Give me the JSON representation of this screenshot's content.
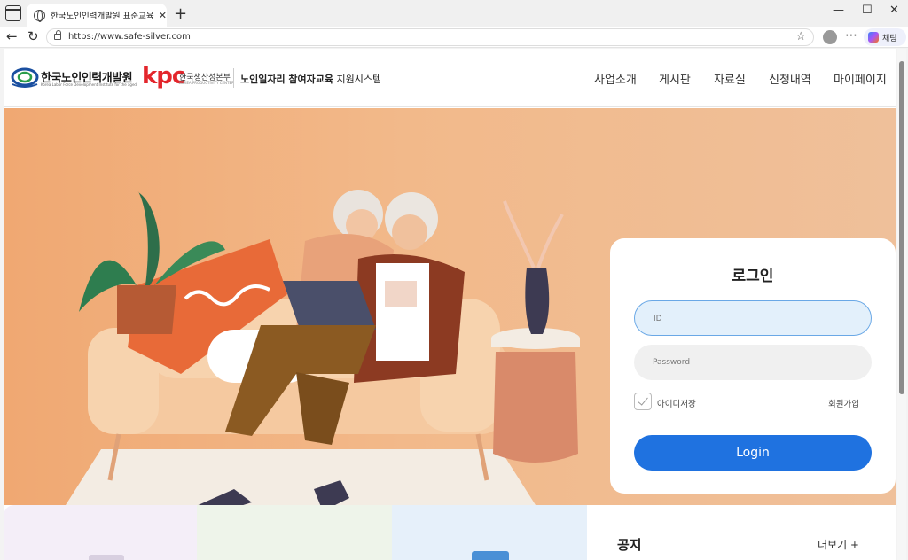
{
  "browser": {
    "tab_title": "한국노인인력개발원 표준교육 시",
    "tab_close": "✕",
    "new_tab": "+",
    "url": "https://www.safe-silver.com",
    "copilot_label": "채팅",
    "window_controls": [
      "—",
      "☐",
      "✕"
    ]
  },
  "header": {
    "logo1_name": "한국노인인력개발원",
    "logo1_sub": "Korea Labor Force Development Institute for the aged",
    "kpc_logo": "kpc",
    "kpc_name": "한국생산성본부",
    "kpc_sub": "KOREA PRODUCTIVITY CENTER",
    "system_title_bold": "노인일자리 참여자교육",
    "system_title_rest": " 지원시스템",
    "menu": [
      "사업소개",
      "게시판",
      "자료실",
      "신청내역",
      "마이페이지"
    ]
  },
  "login": {
    "title": "로그인",
    "id_placeholder": "ID",
    "pw_placeholder": "Password",
    "remember_label": "아이디저장",
    "join_label": "회원가입",
    "button_label": "Login"
  },
  "bottom": {
    "notice_title": "공지",
    "more_label": "더보기 +"
  },
  "colors": {
    "hero_bg": "#f2b98a",
    "login_button": "#1f72e0",
    "id_field_bg": "#e3f0fb",
    "kpc_red": "#e3262c"
  }
}
